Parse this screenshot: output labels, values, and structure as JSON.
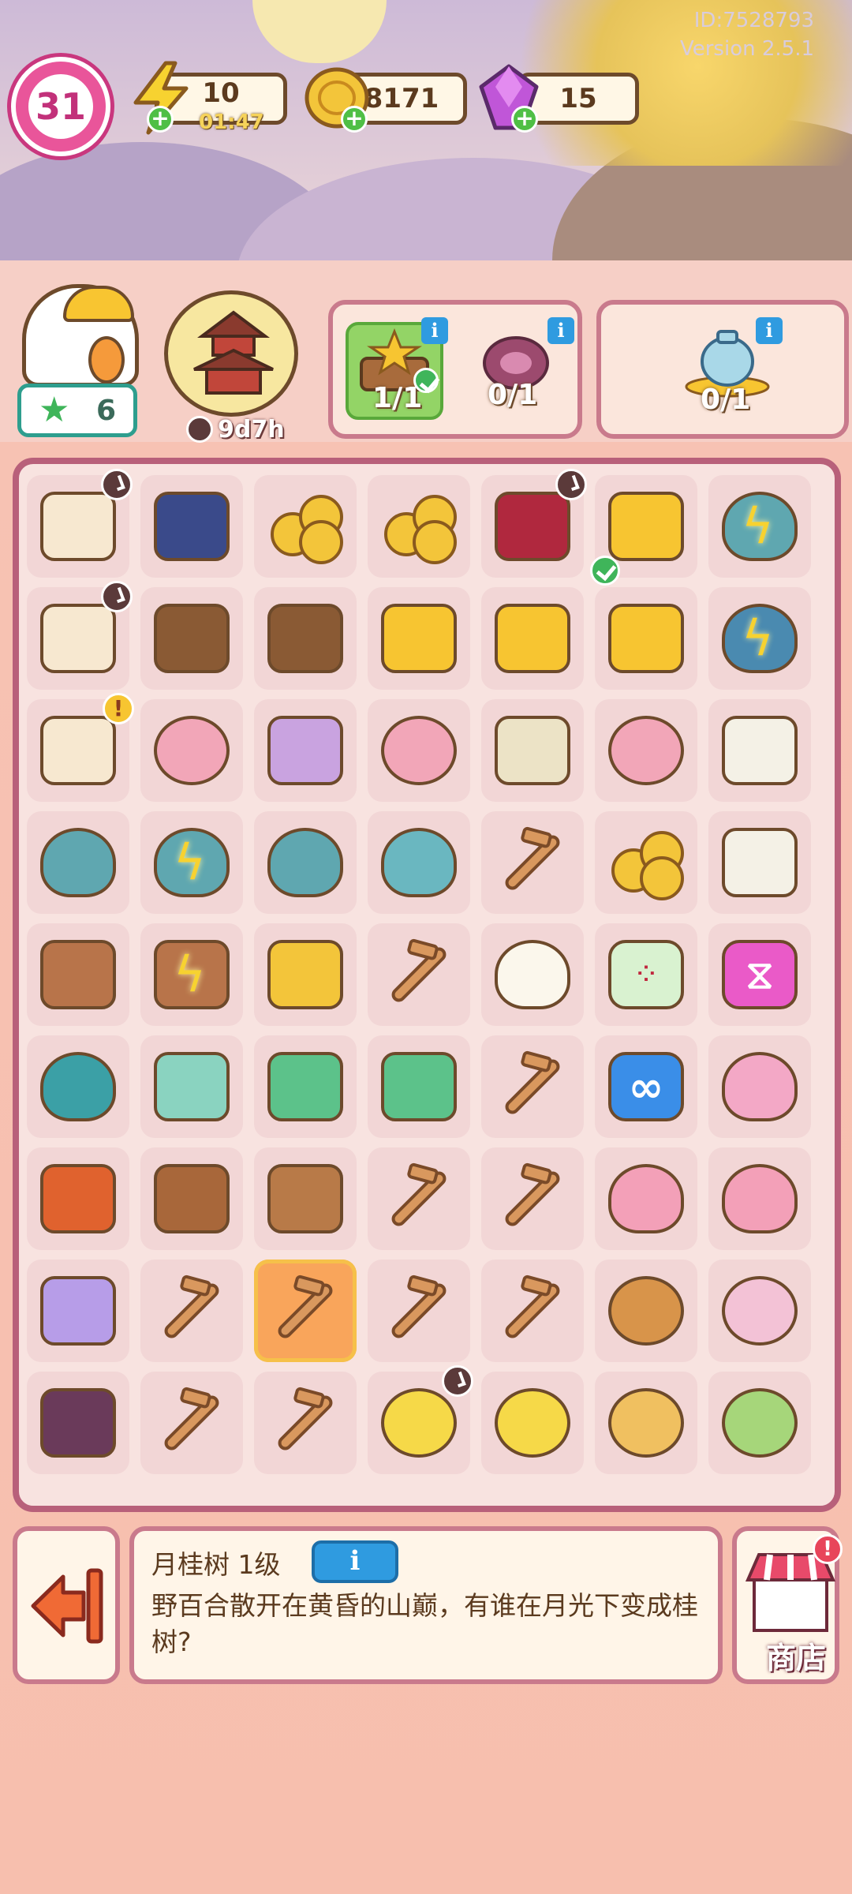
{
  "header": {
    "id_text": "ID:7528793",
    "version_text": "Version 2.5.1",
    "level": "31",
    "energy": {
      "value": "10",
      "timer": "01:47"
    },
    "coins": {
      "value": "8171"
    },
    "gems": {
      "value": "15"
    }
  },
  "event": {
    "star_count": "6",
    "timer": "9d7h"
  },
  "orders": [
    {
      "count": "1/1",
      "done": true
    },
    {
      "count": "0/1",
      "done": false
    },
    {
      "count": "0/1",
      "done": false
    }
  ],
  "selected_item": {
    "title": "月桂树 1级",
    "description": "野百合散开在黄昏的山巅，有谁在月光下变成桂树?"
  },
  "buttons": {
    "info_label": "i",
    "shop_label": "商店"
  },
  "board": {
    "rows": [
      [
        "bunny-mortar",
        "lantern-jar",
        "coin-pile",
        "coins",
        "lantern-cauldron",
        "star-box",
        "osmanthus-tree-energy"
      ],
      [
        "bunny-mortar",
        "soup-bowl",
        "soup-bowl",
        "star",
        "star-plate",
        "star-plate",
        "tree-energy"
      ],
      [
        "bunny-mortar",
        "mooncake-cup",
        "bunny-cup",
        "mooncake-cup",
        "wine-bottle",
        "mooncake-cup",
        "teacup"
      ],
      [
        "osmanthus-tree",
        "osmanthus-tree-energy",
        "osmanthus-tree",
        "sapling",
        "branch",
        "coins",
        "teacup"
      ],
      [
        "flower-basket",
        "flower-basket-energy",
        "osmanthus-branch",
        "branch",
        "cloud",
        "dice",
        "pink-gem"
      ],
      [
        "leaf",
        "cloth",
        "green-tray",
        "green-tray",
        "branch",
        "infinity-gem",
        "pink-scarf"
      ],
      [
        "lunch-box",
        "wooden-ladle",
        "wood-pig",
        "branch",
        "branch",
        "pink-ribbon",
        "pink-ribbon"
      ],
      [
        "purple-towel",
        "branch",
        "branch",
        "branch",
        "branch",
        "mooncake",
        "bunny-cookie"
      ],
      [
        "sauce-bottle",
        "branch",
        "branch",
        "moon",
        "moon-cloud",
        "mooncake-slice",
        "green-mooncake"
      ]
    ]
  }
}
